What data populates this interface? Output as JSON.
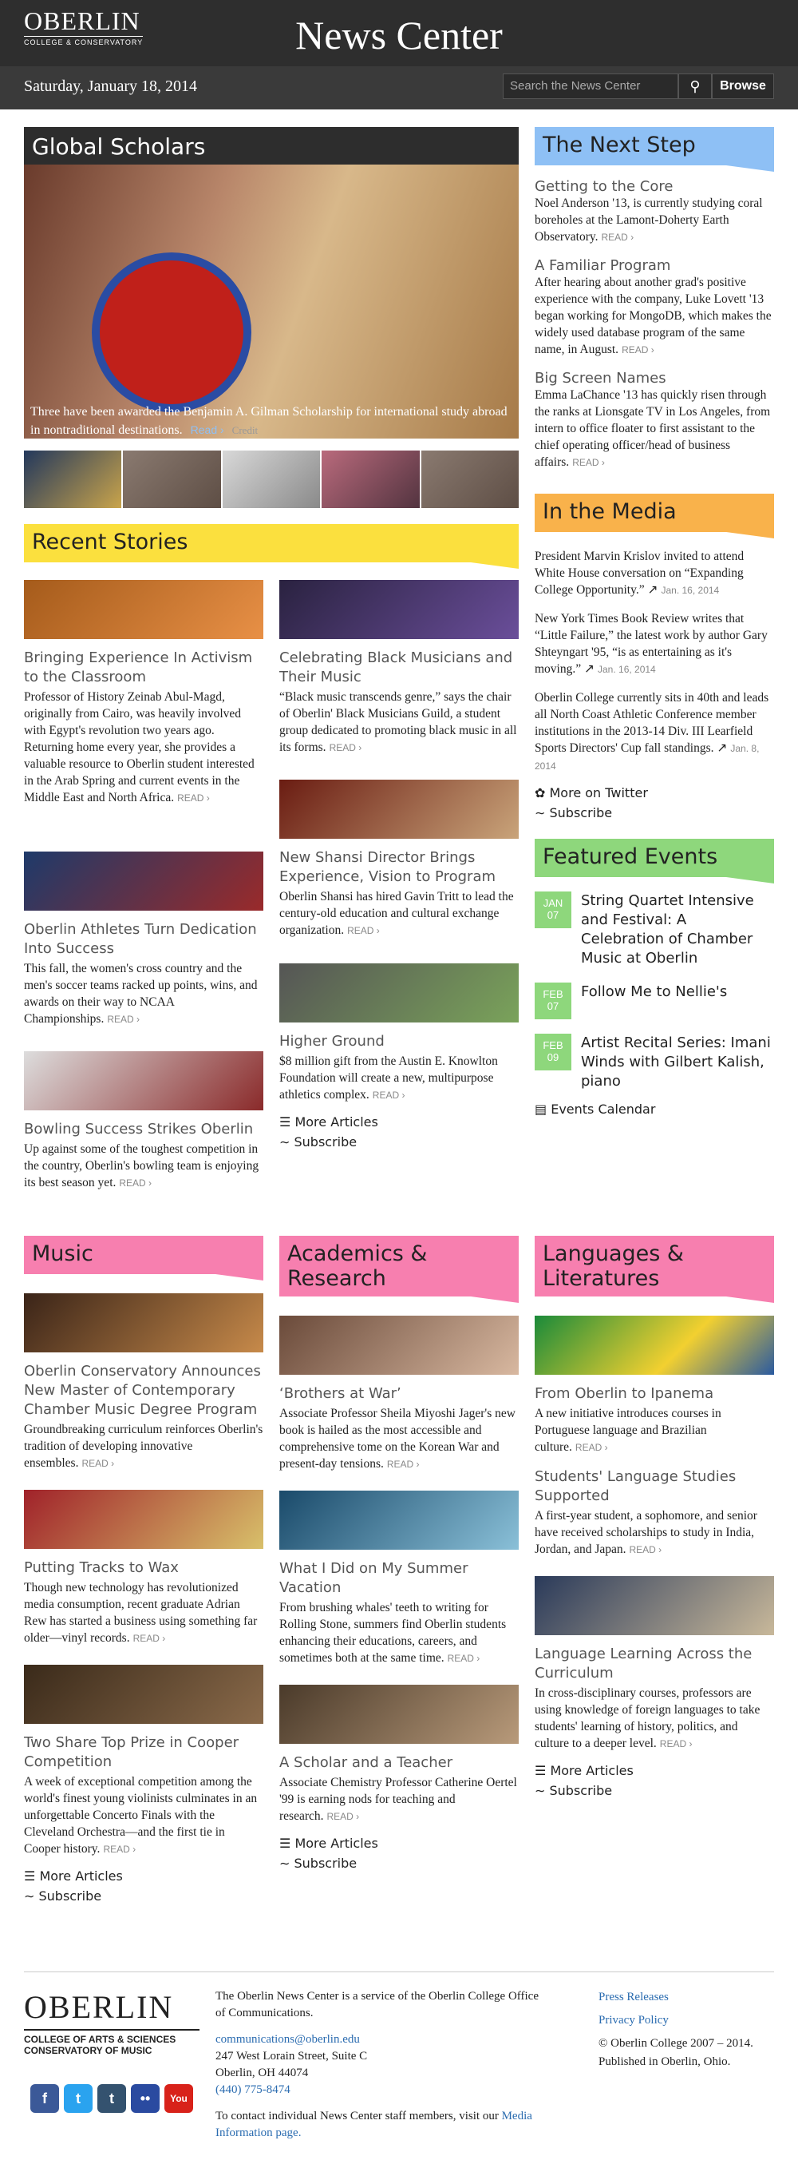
{
  "header": {
    "logo_big": "OBERLIN",
    "logo_small": "COLLEGE & CONSERVATORY",
    "site_title": "News Center",
    "date": "Saturday, January 18, 2014",
    "search_placeholder": "Search the News Center",
    "browse": "Browse"
  },
  "hero": {
    "title": "Global Scholars",
    "caption": "Three have been awarded the Benjamin A. Gilman Scholarship for international study abroad in nontraditional destinations.",
    "read": "Read ›",
    "credit": "Credit"
  },
  "recent": {
    "title": "Recent Stories",
    "stories": [
      {
        "h": "Bringing Experience In Activism to the Classroom",
        "p": "Professor of History Zeinab Abul-Magd, originally from Cairo, was heavily involved with Egypt's revolution two years ago. Returning home every year, she provides a valuable resource to Oberlin student interested in the Arab Spring and current events in the Middle East and North Africa."
      },
      {
        "h": "Celebrating Black Musicians and Their Music",
        "p": "“Black music transcends genre,” says the chair of Oberlin' Black Musicians Guild, a student group dedicated to promoting black music in all its forms."
      },
      {
        "h": "New Shansi Director Brings Experience, Vision to Program",
        "p": "Oberlin Shansi has hired Gavin Tritt to lead the century-old education and cultural exchange organization."
      },
      {
        "h": "Oberlin Athletes Turn Dedication Into Success",
        "p": "This fall, the women's cross country and the men's soccer teams racked up points, wins, and awards on their way to NCAA Championships."
      },
      {
        "h": "Higher Ground",
        "p": "$8 million gift from the Austin E. Knowlton Foundation will create a new, multipurpose athletics complex."
      },
      {
        "h": "Bowling Success Strikes Oberlin",
        "p": "Up against some of the toughest competition in the country, Oberlin's bowling team is enjoying its best season yet."
      }
    ],
    "more": "More Articles",
    "subscribe": "Subscribe",
    "read": "READ ›"
  },
  "nextstep": {
    "title": "The Next Step",
    "items": [
      {
        "h": "Getting to the Core",
        "p": "Noel Anderson '13, is currently studying coral boreholes at the Lamont-Doherty Earth Observatory."
      },
      {
        "h": "A Familiar Program",
        "p": "After hearing about another grad's positive experience with the company, Luke Lovett '13 began working for MongoDB, which makes the widely used database program of the same name, in August."
      },
      {
        "h": "Big Screen Names",
        "p": "Emma LaChance '13 has quickly risen through the ranks at Lionsgate TV in Los Angeles, from intern to office floater to first assistant to the chief operating officer/head of business affairs."
      }
    ]
  },
  "media": {
    "title": "In the Media",
    "items": [
      {
        "p": "President Marvin Krislov invited to attend White House conversation on “Expanding College Opportunity.”",
        "d": "Jan. 16, 2014"
      },
      {
        "p": "New York Times Book Review writes that “Little Failure,” the latest work by author Gary Shteyngart '95, “is as entertaining as it's moving.”",
        "d": "Jan. 16, 2014"
      },
      {
        "p": "Oberlin College currently sits in 40th and leads all North Coast Athletic Conference member institutions in the 2013-14 Div. III Learfield Sports Directors' Cup fall standings.",
        "d": "Jan. 8, 2014"
      }
    ],
    "twitter": "More on Twitter",
    "subscribe": "Subscribe"
  },
  "events": {
    "title": "Featured Events",
    "items": [
      {
        "m": "JAN",
        "d": "07",
        "t": "String Quartet Intensive and Festival: A Celebration of Chamber Music at Oberlin"
      },
      {
        "m": "FEB",
        "d": "07",
        "t": "Follow Me to Nellie's"
      },
      {
        "m": "FEB",
        "d": "09",
        "t": "Artist Recital Series: Imani Winds with Gilbert Kalish, piano"
      }
    ],
    "calendar": "Events Calendar"
  },
  "music": {
    "title": "Music",
    "items": [
      {
        "h": "Oberlin Conservatory Announces New Master of Contemporary Chamber Music Degree Program",
        "p": "Groundbreaking curriculum reinforces Oberlin's tradition of developing innovative ensembles."
      },
      {
        "h": "Putting Tracks to Wax",
        "p": "Though new technology has revolutionized media consumption, recent graduate Adrian Rew has started a business using something far older—vinyl records."
      },
      {
        "h": "Two Share Top Prize in Cooper Competition",
        "p": "A week of exceptional competition among the world's finest young violinists culminates in an unforgettable Concerto Finals with the Cleveland Orchestra—and the first tie in Cooper history."
      }
    ]
  },
  "academics": {
    "title": "Academics & Research",
    "items": [
      {
        "h": "‘Brothers at War’",
        "p": "Associate Professor Sheila Miyoshi Jager's new book is hailed as the most accessible and comprehensive tome on the Korean War and present-day tensions."
      },
      {
        "h": "What I Did on My Summer Vacation",
        "p": "From brushing whales' teeth to writing for Rolling Stone, summers find Oberlin students enhancing their educations, careers, and sometimes both at the same time."
      },
      {
        "h": "A Scholar and a Teacher",
        "p": "Associate Chemistry Professor Catherine Oertel '99 is earning nods for teaching and research."
      }
    ]
  },
  "languages": {
    "title": "Languages & Literatures",
    "items": [
      {
        "h": "From Oberlin to Ipanema",
        "p": "A new initiative introduces courses in Portuguese language and Brazilian culture."
      },
      {
        "h": "Students' Language Studies Supported",
        "p": "A first-year student, a sophomore, and senior have received scholarships to study in India, Jordan, and Japan."
      },
      {
        "h": "Language Learning Across the Curriculum",
        "p": "In cross-disciplinary courses, professors are using knowledge of foreign languages to take students' learning of history, politics, and culture to a deeper level."
      }
    ]
  },
  "footer": {
    "logo": "OBERLIN",
    "logo_sub1": "COLLEGE OF ARTS & SCIENCES",
    "logo_sub2": "CONSERVATORY OF MUSIC",
    "about": "The Oberlin News Center is a service of the Oberlin College Office of Communications.",
    "email": "communications@oberlin.edu",
    "addr1": "247 West Lorain Street, Suite C",
    "addr2": "Oberlin, OH 44074",
    "phone": "(440) 775-8474",
    "contact": "To contact individual News Center staff members, visit our",
    "contact_link": "Media Information page.",
    "press": "Press Releases",
    "privacy": "Privacy Policy",
    "copy": "© Oberlin College 2007 – 2014. Published in Oberlin, Ohio."
  }
}
